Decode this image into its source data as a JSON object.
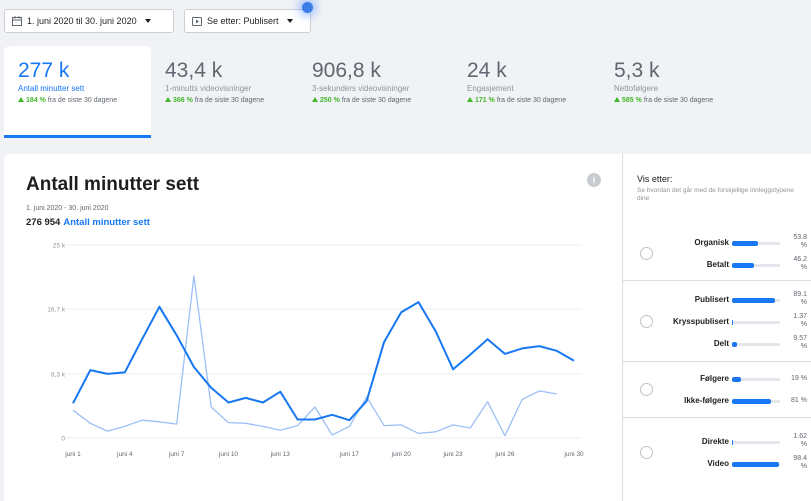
{
  "toolbar": {
    "date_range": "1. juni 2020 til 30. juni 2020",
    "filter": "Se etter: Publisert"
  },
  "stats": [
    {
      "value": "277 k",
      "label": "Antall minutter sett",
      "change": "184 %",
      "suffix": "fra de siste 30 dagene",
      "active": true
    },
    {
      "value": "43,4 k",
      "label": "1-minutts videovisninger",
      "change": "366 %",
      "suffix": "fra de siste 30 dagene"
    },
    {
      "value": "906,8 k",
      "label": "3-sekunders videovisninger",
      "change": "250 %",
      "suffix": "fra de siste 30 dagene"
    },
    {
      "value": "24 k",
      "label": "Engasjement",
      "change": "171 %",
      "suffix": "fra de siste 30 dagene"
    },
    {
      "value": "5,3 k",
      "label": "Nettofølgere",
      "change": "585 %",
      "suffix": "fra de siste 30 dagene"
    }
  ],
  "panel": {
    "title": "Antall minutter sett",
    "info_icon": "i",
    "date": "1. juni 2020 - 30. juni 2020",
    "total_value": "276 954",
    "total_label": "Antall minutter sett"
  },
  "chart_data": {
    "type": "line",
    "x": [
      1,
      2,
      3,
      4,
      5,
      6,
      7,
      8,
      9,
      10,
      11,
      12,
      13,
      14,
      15,
      16,
      17,
      18,
      19,
      20,
      21,
      22,
      23,
      24,
      25,
      26,
      27,
      28,
      29,
      30
    ],
    "xticks": [
      1,
      4,
      7,
      10,
      13,
      17,
      20,
      23,
      26,
      30
    ],
    "xtick_labels": [
      "juni 1",
      "juni 4",
      "juni 7",
      "juni 10",
      "juni 13",
      "juni 17",
      "juni 20",
      "juni 23",
      "juni 26",
      "juni 30"
    ],
    "yticks": [
      0,
      8300,
      16700,
      25000
    ],
    "ytick_labels": [
      "0",
      "8,3 k",
      "16,7 k",
      "25 k"
    ],
    "ylim": [
      0,
      25000
    ],
    "grid": true,
    "series": [
      {
        "values": [
          4500,
          8800,
          8300,
          8500,
          12800,
          17000,
          13300,
          9200,
          6500,
          4600,
          5200,
          4600,
          6000,
          2400,
          2400,
          3000,
          2300,
          4800,
          12400,
          16300,
          17600,
          13800,
          8900,
          10800,
          12800,
          10900,
          11600,
          11900,
          11300,
          10000
        ],
        "color": "#1877f2"
      },
      {
        "values": [
          3600,
          1900,
          900,
          1500,
          2300,
          2100,
          1800,
          21000,
          4000,
          2000,
          1900,
          1500,
          1000,
          1600,
          4000,
          400,
          1500,
          5300,
          1600,
          1700,
          600,
          800,
          1700,
          1300,
          4700,
          300,
          5000,
          6100,
          5700,
          null
        ],
        "color": "#9cc0f5"
      }
    ]
  },
  "breakdown": {
    "title": "Vis etter:",
    "subtitle": "Se hvordan det går med de forskjellige innleggstypene dine",
    "groups": [
      {
        "rows": [
          {
            "label": "Organisk",
            "value": 53.8,
            "pct": "53.8 %"
          },
          {
            "label": "Betalt",
            "value": 46.2,
            "pct": "46.2 %"
          }
        ]
      },
      {
        "rows": [
          {
            "label": "Publisert",
            "value": 89.1,
            "pct": "89.1 %"
          },
          {
            "label": "Krysspublisert",
            "value": 1.37,
            "pct": "1.37 %"
          },
          {
            "label": "Delt",
            "value": 9.57,
            "pct": "9.57 %"
          }
        ]
      },
      {
        "rows": [
          {
            "label": "Følgere",
            "value": 19,
            "pct": "19 %"
          },
          {
            "label": "Ikke-følgere",
            "value": 81,
            "pct": "81 %"
          }
        ]
      },
      {
        "rows": [
          {
            "label": "Direkte",
            "value": 1.62,
            "pct": "1.62 %"
          },
          {
            "label": "Video",
            "value": 98.4,
            "pct": "98.4 %"
          }
        ]
      }
    ]
  }
}
